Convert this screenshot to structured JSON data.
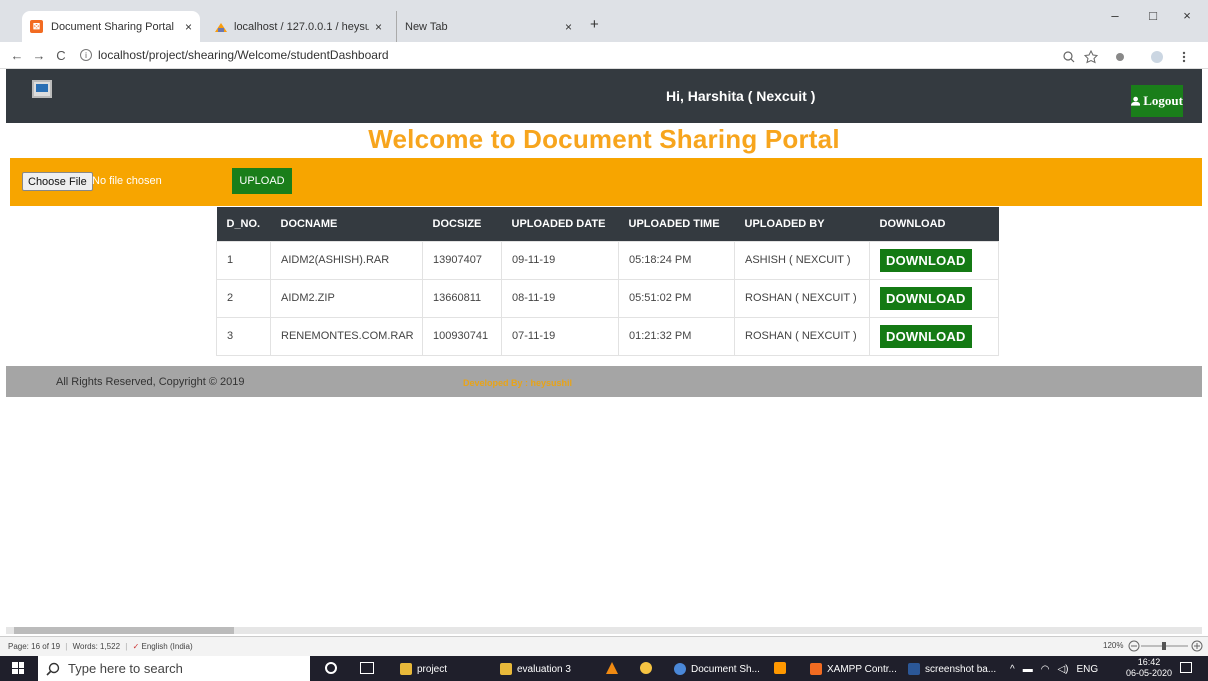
{
  "browser": {
    "tabs": [
      {
        "title": "Document Sharing Portal",
        "close": "×"
      },
      {
        "title": "localhost / 127.0.0.1 / heysushil_",
        "close": "×"
      },
      {
        "title": "New Tab",
        "close": "×"
      }
    ],
    "new_tab": "+",
    "window_controls": {
      "minimize": "–",
      "maximize": "□",
      "close": "×"
    },
    "nav": {
      "back": "←",
      "forward": "→",
      "reload": "C"
    },
    "url": "localhost/project/shearing/Welcome/studentDashboard",
    "url_info_icon": "i",
    "toolbar_icons": [
      "zoom-icon",
      "star-icon",
      "extension-icon",
      "profile-icon",
      "menu-icon"
    ]
  },
  "header": {
    "greeting": "Hi, Harshita ( Nexcuit )",
    "logout": "Logout",
    "logout_icon": "user-icon"
  },
  "page": {
    "welcome_title": "Welcome to Document Sharing Portal",
    "choose_file": "Choose File",
    "no_file": "No file chosen",
    "upload": "UPLOAD"
  },
  "table": {
    "headers": [
      "D_NO.",
      "DOCNAME",
      "DOCSIZE",
      "UPLOADED DATE",
      "UPLOADED TIME",
      "UPLOADED BY",
      "DOWNLOAD"
    ],
    "rows": [
      {
        "no": "1",
        "name": "AIDM2(ASHISH).RAR",
        "size": "13907407",
        "date": "09-11-19",
        "time": "05:18:24 PM",
        "by": "ASHISH ( NEXCUIT )",
        "action": "DOWNLOAD"
      },
      {
        "no": "2",
        "name": "AIDM2.ZIP",
        "size": "13660811",
        "date": "08-11-19",
        "time": "05:51:02 PM",
        "by": "ROSHAN ( NEXCUIT )",
        "action": "DOWNLOAD"
      },
      {
        "no": "3",
        "name": "RENEMONTES.COM.RAR",
        "size": "100930741",
        "date": "07-11-19",
        "time": "01:21:32 PM",
        "by": "ROSHAN ( NEXCUIT )",
        "action": "DOWNLOAD"
      }
    ]
  },
  "footer": {
    "copyright": "All Rights Reserved, Copyright © 2019",
    "developed": "Developed By : heysushil"
  },
  "word_status": {
    "page": "Page: 16 of 19",
    "words": "Words: 1,522",
    "language": "English (India)",
    "zoom": "120%"
  },
  "taskbar": {
    "search_placeholder": "Type here to search",
    "items": [
      {
        "label": "project",
        "color": "#e8b93a"
      },
      {
        "label": "evaluation 3",
        "color": "#e8b93a"
      },
      {
        "label": "Document Sh...",
        "color": "#4a88d8"
      },
      {
        "label": "XAMPP Contr...",
        "color": "#f26b21"
      },
      {
        "label": "screenshot ba...",
        "color": "#2b5797"
      }
    ],
    "language": "ENG",
    "time": "16:42",
    "date": "06-05-2020"
  }
}
